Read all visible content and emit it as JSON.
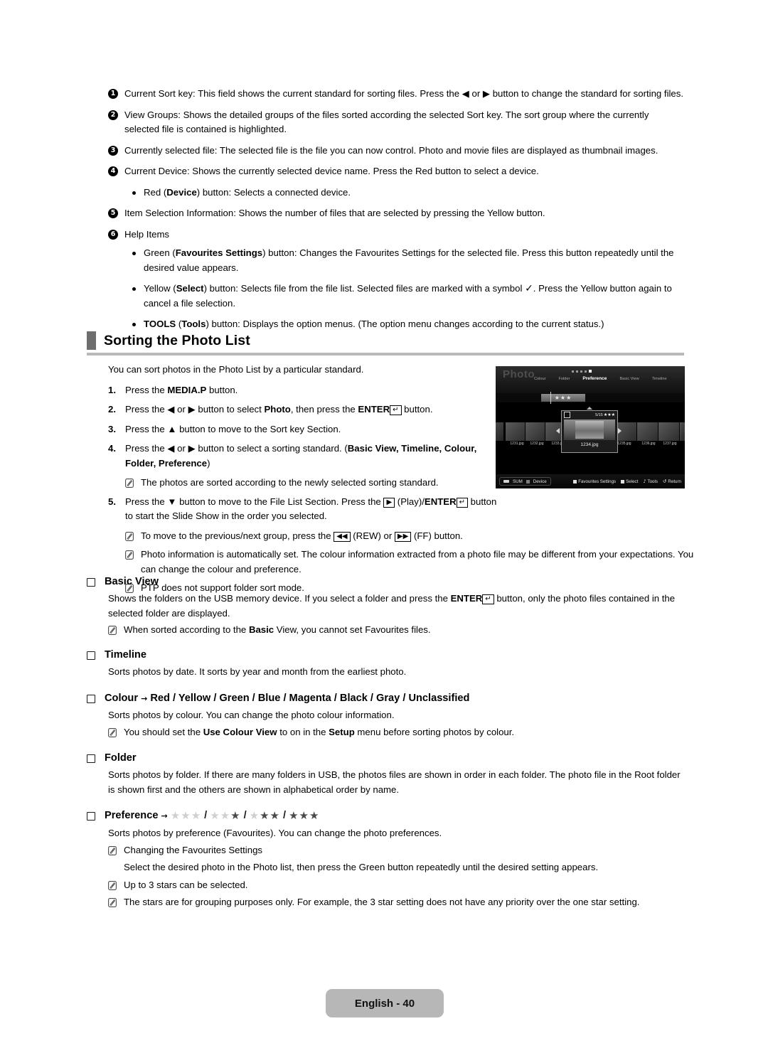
{
  "callouts": [
    {
      "num": "1",
      "num_glyph": "❶",
      "text": "Current Sort key: This field shows the current standard for sorting files. Press the ◀ or ▶ button to change the standard for sorting files."
    },
    {
      "num": "2",
      "num_glyph": "❷",
      "text": "View Groups: Shows the detailed groups of the files sorted according the selected Sort key. The sort group where the currently selected file is contained is highlighted."
    },
    {
      "num": "3",
      "num_glyph": "❸",
      "text": "Currently selected file: The selected file is the file you can now control. Photo and movie files are displayed as thumbnail images."
    },
    {
      "num": "4",
      "num_glyph": "❹",
      "text": "Current Device: Shows the currently selected device name. Press the Red button to select a device."
    },
    {
      "num": "5",
      "num_glyph": "❺",
      "text": "Item Selection Information: Shows the number of files that are selected by pressing the Yellow button."
    },
    {
      "num": "6",
      "num_glyph": "❻",
      "text": "Help Items"
    }
  ],
  "device_bullet": {
    "prefix": "Red (",
    "bold": "Device",
    "suffix": ") button: Selects a connected device."
  },
  "help_bullets": [
    {
      "prefix": "Green (",
      "bold": "Favourites Settings",
      "suffix": ") button: Changes the Favourites Settings for the selected file. Press this button repeatedly until the desired value appears."
    },
    {
      "prefix": "Yellow (",
      "bold": "Select",
      "suffix": ") button: Selects file from the file list. Selected files are marked with a symbol",
      "symbol": "✓",
      "tail": ". Press the Yellow button again to cancel a file selection."
    },
    {
      "bold_lead": "TOOLS",
      "prefix2": " (",
      "bold2": "Tools",
      "suffix2": ") button: Displays the option menus. (The option menu changes according to the current status.)"
    }
  ],
  "section": {
    "title": "Sorting the Photo List",
    "intro": "You can sort photos in the Photo List by a particular standard."
  },
  "steps": [
    {
      "num": "1.",
      "pre": "Press the ",
      "bold": "MEDIA.P",
      "post": " button."
    },
    {
      "num": "2.",
      "pre": "Press the ◀ or ▶ button to select ",
      "bold": "Photo",
      "mid": ", then press the ",
      "bold2": "ENTER",
      "key": "↵",
      "post": " button."
    },
    {
      "num": "3.",
      "pre": "Press the ▲ button to move to the Sort key Section.",
      "bold": "",
      "post": ""
    },
    {
      "num": "4.",
      "pre": "Press the ◀ or ▶ button to select a sorting standard. (",
      "bold": "Basic View, Timeline, Colour, Folder, Preference",
      "post": ")"
    }
  ],
  "step4_note": "The photos are sorted according to the newly selected sorting standard.",
  "step5": {
    "num": "5.",
    "pre": "Press the ▼ button to move to the File List Section. Press the ",
    "key_play": "▶",
    "mid": " (Play)/",
    "bold": "ENTER",
    "key_enter": "↵",
    "post": " button to start the Slide Show in the order you selected."
  },
  "step5_notes": [
    {
      "pre": "To move to the previous/next group, press the ",
      "key1": "◀◀",
      "mid": " (REW) or ",
      "key2": "▶▶",
      "post": " (FF) button."
    },
    {
      "plain": "Photo information is automatically set. The colour information extracted from a photo file may be different from your expectations. You can change the colour and preference."
    },
    {
      "plain": "PTP does not support folder sort mode."
    }
  ],
  "subsections": [
    {
      "title": "Basic View",
      "body_pre": "Shows the folders on the USB memory device. If you select a folder and press the ",
      "body_bold": "ENTER",
      "body_key": "↵",
      "body_post": " button, only the photo files contained in the selected folder are displayed.",
      "note_pre": "When sorted according to the ",
      "note_bold": "Basic",
      "note_post": " View, you cannot set Favourites files."
    },
    {
      "title": "Timeline",
      "body": "Sorts photos by date. It sorts by year and month from the earliest photo."
    },
    {
      "title": "Colour",
      "title_arrow": "→",
      "title_values": "Red / Yellow / Green / Blue / Magenta / Black / Gray / Unclassified",
      "body": "Sorts photos by colour. You can change the photo colour information.",
      "note_pre": "You should set the ",
      "note_bold": "Use Colour View",
      "note_mid": " to on in the ",
      "note_bold2": "Setup",
      "note_post": " menu before sorting photos by colour."
    },
    {
      "title": "Folder",
      "body": "Sorts photos by folder. If there are many folders in USB, the photos files are shown in order in each folder. The photo file in the Root folder is shown first and the others are shown in alphabetical order by name."
    },
    {
      "title": "Preference",
      "title_arrow": "→",
      "star_groups": [
        0,
        1,
        2,
        3
      ],
      "star_total": 3,
      "body": "Sorts photos by preference (Favourites). You can change the photo preferences.",
      "notes": [
        "Changing the Favourites Settings",
        "Up to 3 stars can be selected.",
        "The stars are for grouping purposes only. For example, the 3 star setting does not have any priority over the one star setting."
      ],
      "sub_line": "Select the desired photo in the Photo list, then press the Green button repeatedly until the desired setting appears."
    }
  ],
  "tv": {
    "title": "Photo",
    "tabs": [
      {
        "label": "Colour",
        "selected": false
      },
      {
        "label": "Folder",
        "selected": false
      },
      {
        "label": "Preference",
        "selected": true
      },
      {
        "label": "Basic View",
        "selected": false
      },
      {
        "label": "Timeline",
        "selected": false
      }
    ],
    "page_dots": 5,
    "page_dot_current": 5,
    "sort_group_stars": "★★★",
    "thumbnails": [
      "1231.jpg",
      "1232.jpg",
      "1233.jpg",
      "1235.jpg",
      "1236.jpg",
      "1237.jpg"
    ],
    "selected_file": "1234.jpg",
    "selected_index_label": "5/15",
    "selected_stars": "★★★",
    "device_label": "Device",
    "device_name": "SUM",
    "help": [
      {
        "icon": "green-square",
        "label": "Favourites Settings"
      },
      {
        "icon": "yellow-square",
        "label": "Select"
      },
      {
        "icon": "tools-glyph",
        "glyph": "♪",
        "label": "Tools"
      },
      {
        "icon": "return-glyph",
        "glyph": "↺",
        "label": "Return"
      }
    ]
  },
  "footer": {
    "label": "English - 40"
  }
}
